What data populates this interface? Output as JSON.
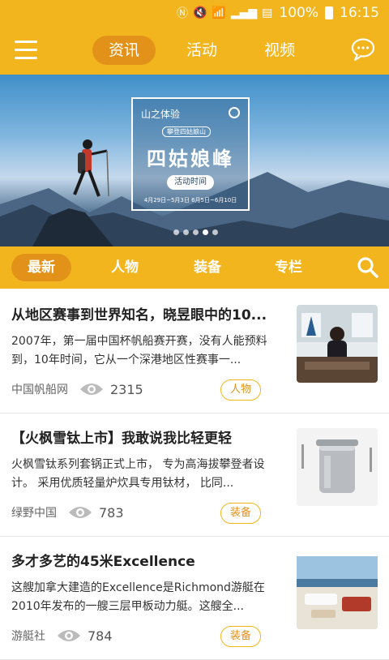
{
  "status": {
    "battery": "100%",
    "time": "16:15"
  },
  "top_tabs": [
    {
      "label": "资讯",
      "active": true
    },
    {
      "label": "活动",
      "active": false
    },
    {
      "label": "视频",
      "active": false
    }
  ],
  "banner": {
    "small_title": "山之体验",
    "badge": "攀登四姑娘山",
    "headline": "四姑娘峰",
    "button": "活动时间",
    "dates": "4月29日~5月3日  6月5日~6月10日",
    "slide_count": 5,
    "active_slide": 4
  },
  "categories": [
    {
      "label": "最新",
      "active": true
    },
    {
      "label": "人物",
      "active": false
    },
    {
      "label": "装备",
      "active": false
    },
    {
      "label": "专栏",
      "active": false
    }
  ],
  "articles": [
    {
      "title": "从地区赛事到世界知名，晓昱眼中的10...",
      "desc": "2007年，第一届中国杯帆船赛开赛，没有人能预料到，10年时间，它从一个深港地区性赛事一...",
      "source": "中国帆船网",
      "views": "2315",
      "tag": "人物",
      "thumb": "office-portrait"
    },
    {
      "title": "【火枫雪钛上市】我敢说我比轻更轻",
      "desc": "火枫雪钛系列套锅正式上市， 专为高海拔攀登者设计。 采用优质轻量炉炊具专用钛材， 比同...",
      "source": "绿野中国",
      "views": "783",
      "tag": "装备",
      "thumb": "titanium-pot"
    },
    {
      "title": "多才多艺的45米Excellence",
      "desc": "这艘加拿大建造的Excellence是Richmond游艇在2010年发布的一艘三层甲板动力艇。这艘全...",
      "source": "游艇社",
      "views": "784",
      "tag": "装备",
      "thumb": "yacht-deck"
    }
  ],
  "colors": {
    "accent": "#f2b51d",
    "accent_dark": "#e39219",
    "tag_text": "#e39219"
  }
}
